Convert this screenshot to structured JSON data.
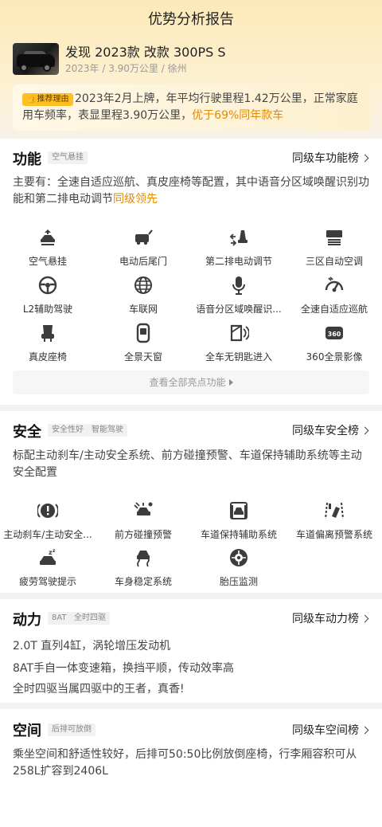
{
  "page_title": "优势分析报告",
  "car": {
    "name": "发现 2023款 改款 300PS S",
    "meta": "2023年 / 3.90万公里 / 徐州"
  },
  "reason": {
    "badge": "推荐理由",
    "text": "2023年2月上牌，年平均行驶里程1.42万公里，正常家庭用车频率，表显里程3.90万公里，",
    "highlight": "优于69%同年款车"
  },
  "function": {
    "title": "功能",
    "tags": [
      "空气悬挂"
    ],
    "rank_link": "同级车功能榜",
    "desc": "主要有：全速自适应巡航、真皮座椅等配置，其中语音分区域唤醒识别功能和第二排电动调节",
    "desc_highlight": "同级领先",
    "items": [
      {
        "label": "空气悬挂",
        "icon": "air-suspension-icon"
      },
      {
        "label": "电动后尾门",
        "icon": "power-tailgate-icon"
      },
      {
        "label": "第二排电动调节",
        "icon": "second-row-seat-icon"
      },
      {
        "label": "三区自动空调",
        "icon": "climate-control-icon"
      },
      {
        "label": "L2辅助驾驶",
        "icon": "steering-wheel-icon"
      },
      {
        "label": "车联网",
        "icon": "connected-globe-icon"
      },
      {
        "label": "语音分区域唤醒识...",
        "icon": "microphone-icon"
      },
      {
        "label": "全速自适应巡航",
        "icon": "cruise-gauge-icon"
      },
      {
        "label": "真皮座椅",
        "icon": "leather-seat-icon"
      },
      {
        "label": "全景天窗",
        "icon": "sunroof-icon"
      },
      {
        "label": "全车无钥匙进入",
        "icon": "keyless-entry-icon"
      },
      {
        "label": "360全景影像",
        "icon": "camera-360-icon"
      }
    ],
    "view_all": "查看全部亮点功能"
  },
  "safety": {
    "title": "安全",
    "tags": [
      "安全性好",
      "智能驾驶"
    ],
    "rank_link": "同级车安全榜",
    "desc": "标配主动刹车/主动安全系统、前方碰撞预警、车道保持辅助系统等主动安全配置",
    "items": [
      {
        "label": "主动刹车/主动安全...",
        "icon": "brake-warning-icon"
      },
      {
        "label": "前方碰撞预警",
        "icon": "collision-warning-icon"
      },
      {
        "label": "车道保持辅助系统",
        "icon": "lane-keep-icon"
      },
      {
        "label": "车道偏离预警系统",
        "icon": "lane-departure-icon"
      },
      {
        "label": "疲劳驾驶提示",
        "icon": "fatigue-icon"
      },
      {
        "label": "车身稳定系统",
        "icon": "stability-icon"
      },
      {
        "label": "胎压监测",
        "icon": "tire-pressure-icon"
      }
    ]
  },
  "power": {
    "title": "动力",
    "tags": [
      "8AT",
      "全时四驱"
    ],
    "rank_link": "同级车动力榜",
    "lines": [
      "2.0T 直列4缸，涡轮增压发动机",
      "8AT手自一体变速箱，换挡平顺，传动效率高",
      "全时四驱当属四驱中的王者，真香!"
    ]
  },
  "space": {
    "title": "空间",
    "tags": [
      "后排可放倒"
    ],
    "rank_link": "同级车空间榜",
    "desc": "乘坐空间和舒适性较好，后排可50:50比例放倒座椅，行李厢容积可从258L扩容到2406L"
  },
  "colors": {
    "accent": "#e38a00",
    "badge": "#ffbf24",
    "icon": "#3c3c3c"
  }
}
